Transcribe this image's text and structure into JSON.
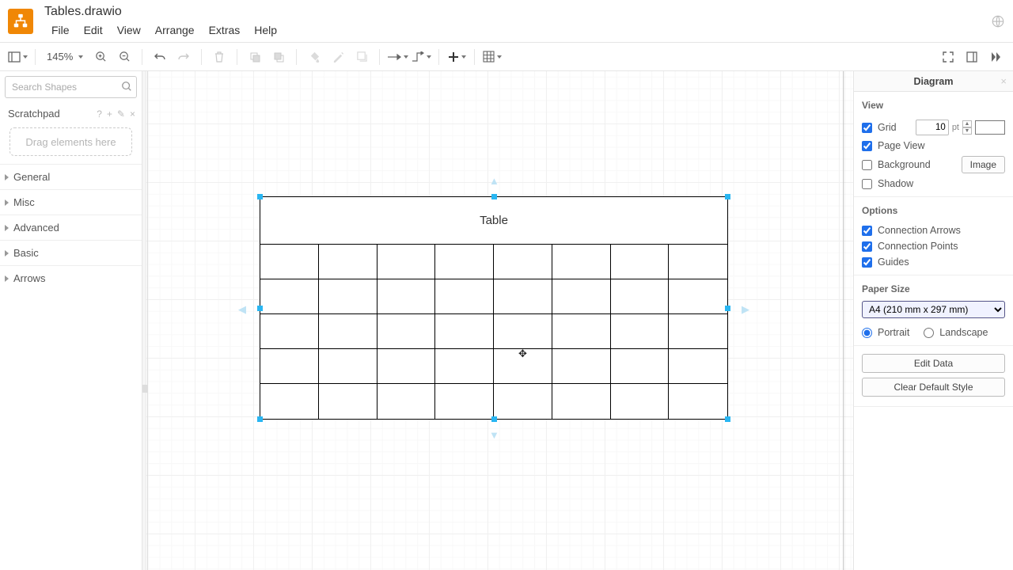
{
  "doc_title": "Tables.drawio",
  "menus": [
    "File",
    "Edit",
    "View",
    "Arrange",
    "Extras",
    "Help"
  ],
  "toolbar": {
    "zoom": "145%"
  },
  "sidebar": {
    "search_placeholder": "Search Shapes",
    "scratchpad_label": "Scratchpad",
    "drop_hint": "Drag elements here",
    "sections": [
      "General",
      "Misc",
      "Advanced",
      "Basic",
      "Arrows"
    ]
  },
  "canvas": {
    "table_caption": "Table",
    "rows": 5,
    "cols": 8
  },
  "format": {
    "title": "Diagram",
    "view_label": "View",
    "grid_label": "Grid",
    "grid_value": "10",
    "grid_unit": "pt",
    "pageview_label": "Page View",
    "background_label": "Background",
    "image_btn": "Image",
    "shadow_label": "Shadow",
    "options_label": "Options",
    "conn_arrows": "Connection Arrows",
    "conn_points": "Connection Points",
    "guides": "Guides",
    "paper_label": "Paper Size",
    "paper_value": "A4 (210 mm x 297 mm)",
    "portrait": "Portrait",
    "landscape": "Landscape",
    "edit_data": "Edit Data",
    "clear_style": "Clear Default Style"
  }
}
